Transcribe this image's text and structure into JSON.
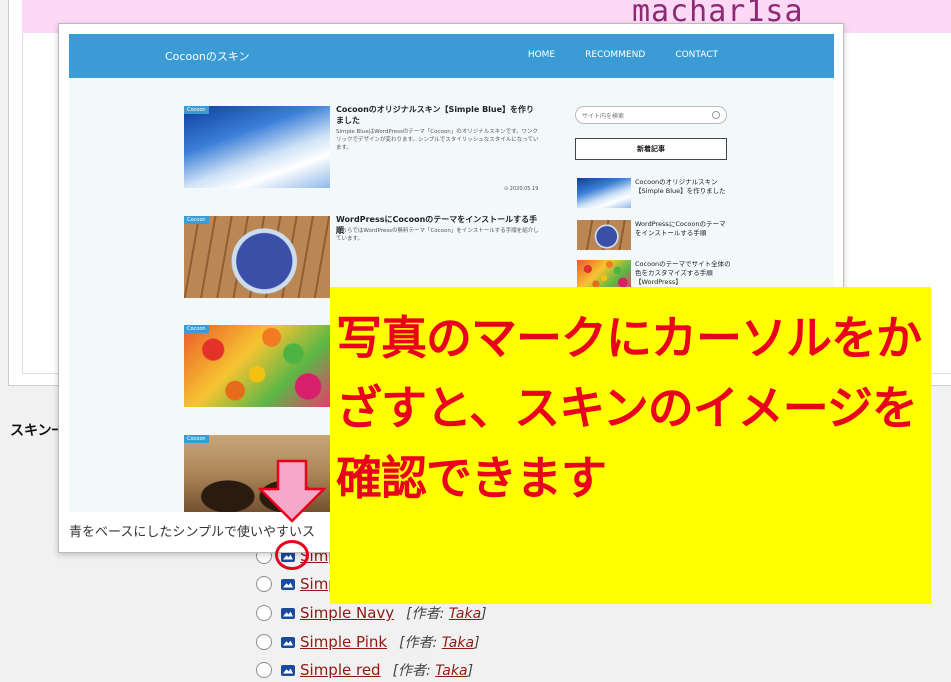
{
  "background": {
    "logo_text": "machar1sa",
    "skin_section_label": "スキン一"
  },
  "preview": {
    "site_title": "Cocoonのスキン",
    "menu": [
      "HOME",
      "RECOMMEND",
      "CONTACT"
    ],
    "posts": [
      {
        "category": "Cocoon",
        "title": "Cocoonのオリジナルスキン【Simple Blue】を作りました",
        "excerpt": "Simple BlueはWordPressのテーマ「Cocoon」のオリジナルスキンです。ワンクリックでデザインが変わります。シンプルでスタイリッシュなスタイルになっています。",
        "date": "⊙ 2020.05.19"
      },
      {
        "category": "Cocoon",
        "title": "WordPressにCocoonのテーマをインストールする手順",
        "excerpt": "こちらではWordPressの無料テーマ「Cocoon」をインストールする手順を紹介しています。",
        "date": ""
      },
      {
        "category": "Cocoon",
        "title": "",
        "excerpt": "",
        "date": ""
      },
      {
        "category": "Cocoon",
        "title": "",
        "excerpt": "",
        "date": ""
      }
    ],
    "sidebar": {
      "search_placeholder": "サイト内を検索",
      "new_posts_heading": "新着記事",
      "items": [
        "Cocoonのオリジナルスキン【Simple Blue】を作りました",
        "WordPressにCocoonのテーマをインストールする手順",
        "Cocoonのテーマでサイト全体の色をカスタマイズする手順【WordPress】"
      ]
    },
    "caption": "青をベースにしたシンプルで使いやすいス"
  },
  "skins": [
    {
      "name": "Simp",
      "author_prefix": "",
      "author": ""
    },
    {
      "name": "Simp",
      "author_prefix": "",
      "author": ""
    },
    {
      "name": "Simple Navy",
      "author_prefix": "[作者: ",
      "author": "Taka",
      "author_suffix": "]"
    },
    {
      "name": "Simple Pink",
      "author_prefix": "[作者: ",
      "author": "Taka",
      "author_suffix": "]"
    },
    {
      "name": "Simple red",
      "author_prefix": "[作者: ",
      "author": "Taka",
      "author_suffix": "]"
    }
  ],
  "annotation": {
    "text": "写真のマークにカーソルをかざすと、スキンのイメージを確認できます",
    "text_color": "#e8001c",
    "background_color": "#ffff00",
    "arrow_color": "#f7a7c8"
  }
}
